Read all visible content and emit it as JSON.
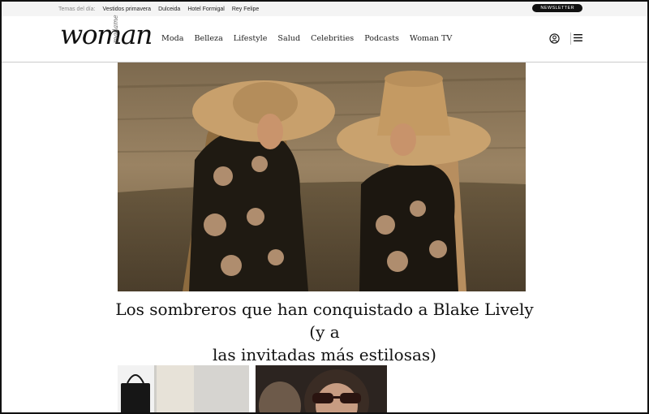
{
  "topbar": {
    "label": "Temas del día:",
    "topics": [
      "Vestidos primavera",
      "Dulceida",
      "Hotel Formigal",
      "Rey Felipe"
    ],
    "newsletter": "NEWSLETTER"
  },
  "header": {
    "logo": "woman",
    "logo_sub": "madame",
    "nav": [
      "Moda",
      "Belleza",
      "Lifestyle",
      "Salud",
      "Celebrities",
      "Podcasts",
      "Woman TV"
    ]
  },
  "article": {
    "title_line1": "Los sombreros que han conquistado a Blake Lively (y a",
    "title_line2": "las invitadas más estilosas)"
  },
  "icons": {
    "user": "user-icon",
    "menu": "menu-icon"
  }
}
